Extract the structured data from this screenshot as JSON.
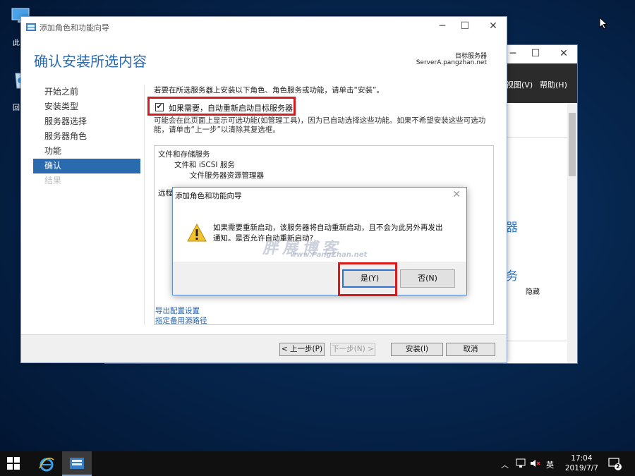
{
  "desktop": {
    "icons": [
      {
        "label": "此"
      },
      {
        "label": "回"
      }
    ]
  },
  "background_window": {
    "menu": [
      "视图(V)",
      "帮助(H)"
    ],
    "fragments": [
      "器",
      "务"
    ],
    "hide_label": "隐藏"
  },
  "wizard": {
    "title": "添加角色和功能向导",
    "heading": "确认安装所选内容",
    "dest_label": "目标服务器",
    "dest_server": "ServerA.pangzhan.net",
    "nav": [
      {
        "label": "开始之前",
        "state": "normal"
      },
      {
        "label": "安装类型",
        "state": "normal"
      },
      {
        "label": "服务器选择",
        "state": "normal"
      },
      {
        "label": "服务器角色",
        "state": "normal"
      },
      {
        "label": "功能",
        "state": "normal"
      },
      {
        "label": "确认",
        "state": "active"
      },
      {
        "label": "结果",
        "state": "disabled"
      }
    ],
    "intro": "若要在所选服务器上安装以下角色、角色服务或功能，请单击“安装”。",
    "restart_checkbox": {
      "label": "如果需要，自动重新启动目标服务器",
      "checked": true
    },
    "note_line1": "可能会在此页面上显示可选功能(如管理工具)，因为已自动选择这些功能。如果不希望安装这些可选功",
    "note_line2": "能，请单击“上一步”以清除其复选框。",
    "features": [
      {
        "label": "文件和存储服务",
        "level": 0
      },
      {
        "label": "文件和 iSCSI 服务",
        "level": 1
      },
      {
        "label": "文件服务器资源管理器",
        "level": 2
      },
      {
        "label": "远程",
        "level": 0
      }
    ],
    "links": {
      "export": "导出配置设置",
      "alt_source": "指定备用源路径"
    },
    "buttons": {
      "prev": "< 上一步(P)",
      "next": "下一步(N) >",
      "install": "安装(I)",
      "cancel": "取消"
    }
  },
  "dialog": {
    "title": "添加角色和功能向导",
    "message_line1": "如果需要重新启动，该服务器将自动重新启动，且不会为此另外再发出",
    "message_line2": "通知。是否允许自动重新启动?",
    "yes": "是(Y)",
    "no": "否(N)"
  },
  "watermark": {
    "main": "胖展博客",
    "sub": "www.PangZhan.net"
  },
  "taskbar": {
    "ime": "英",
    "time": "17:04",
    "date": "2019/7/7",
    "notification_count": "2"
  }
}
